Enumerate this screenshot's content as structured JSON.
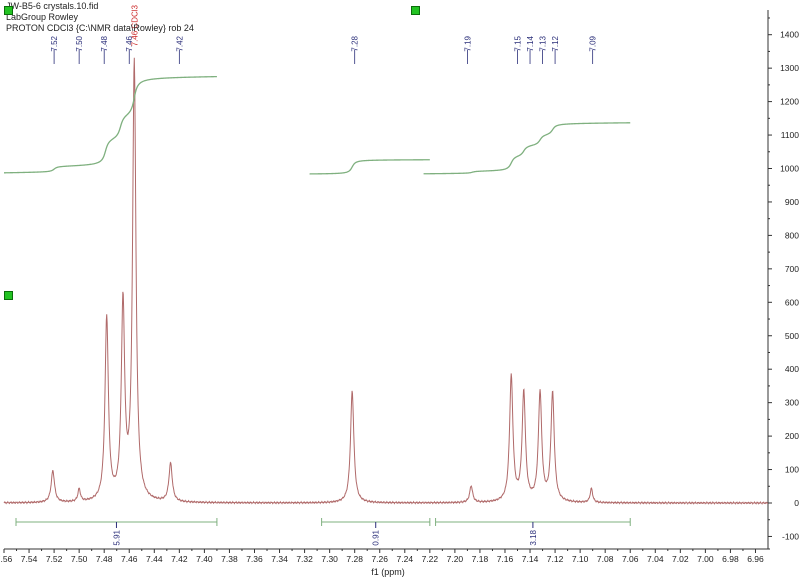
{
  "header": {
    "line1": "JW-B5-6 crystals.10.fid",
    "line2": "LabGroup Rowley",
    "line3": "PROTON CDCl3 {C:\\NMR data\\Rowley} rob 24"
  },
  "chart_data": {
    "type": "line",
    "title": "",
    "xlabel": "f1 (ppm)",
    "ylabel": "",
    "xlim": [
      7.56,
      6.95
    ],
    "ylim": [
      -130,
      1450
    ],
    "x_reversed": true,
    "x_ticks": [
      "7.56",
      "7.54",
      "7.52",
      "7.50",
      "7.48",
      "7.46",
      "7.44",
      "7.42",
      "7.40",
      "7.38",
      "7.36",
      "7.34",
      "7.32",
      "7.30",
      "7.28",
      "7.26",
      "7.24",
      "7.22",
      "7.20",
      "7.18",
      "7.16",
      "7.14",
      "7.12",
      "7.10",
      "7.08",
      "7.06",
      "7.04",
      "7.02",
      "7.00",
      "6.98",
      "6.96"
    ],
    "y_ticks": [
      "-100",
      "0",
      "100",
      "200",
      "300",
      "400",
      "500",
      "600",
      "700",
      "800",
      "900",
      "1000",
      "1100",
      "1200",
      "1300",
      "1400"
    ],
    "series": [
      {
        "color": "#b06a6a",
        "peaks": [
          {
            "x": 7.521,
            "y": 95,
            "w": 0.0016
          },
          {
            "x": 7.5,
            "y": 38,
            "w": 0.0012
          },
          {
            "x": 7.478,
            "y": 550,
            "w": 0.0016
          },
          {
            "x": 7.465,
            "y": 585,
            "w": 0.0016
          },
          {
            "x": 7.456,
            "y": 1310,
            "w": 0.0016
          },
          {
            "x": 7.427,
            "y": 115,
            "w": 0.0016
          },
          {
            "x": 7.282,
            "y": 335,
            "w": 0.0016
          },
          {
            "x": 7.187,
            "y": 50,
            "w": 0.0014
          },
          {
            "x": 7.155,
            "y": 375,
            "w": 0.0016
          },
          {
            "x": 7.145,
            "y": 325,
            "w": 0.0016
          },
          {
            "x": 7.132,
            "y": 325,
            "w": 0.0016
          },
          {
            "x": 7.122,
            "y": 325,
            "w": 0.0016
          },
          {
            "x": 7.091,
            "y": 42,
            "w": 0.0012
          }
        ]
      }
    ],
    "integral_color": "#7fb07f",
    "integrals": [
      {
        "from": 7.56,
        "to": 7.39,
        "label": "5.91",
        "steps": [
          [
            7.52,
            0.06
          ],
          [
            7.479,
            0.28
          ],
          [
            7.467,
            0.26
          ],
          [
            7.456,
            0.4
          ]
        ]
      },
      {
        "from": 7.316,
        "to": 7.22,
        "label": "0.91",
        "steps": [
          [
            7.282,
            1.0
          ]
        ]
      },
      {
        "from": 7.225,
        "to": 7.06,
        "label": "3.18",
        "steps": [
          [
            7.186,
            0.04
          ],
          [
            7.155,
            0.3
          ],
          [
            7.145,
            0.22
          ],
          [
            7.132,
            0.22
          ],
          [
            7.122,
            0.22
          ]
        ]
      }
    ],
    "peak_labels": [
      {
        "x": 7.52,
        "text": "7.52"
      },
      {
        "x": 7.5,
        "text": "7.50"
      },
      {
        "x": 7.48,
        "text": "7.48"
      },
      {
        "x": 7.46,
        "text": "7.46"
      },
      {
        "x": 7.42,
        "text": "7.42"
      },
      {
        "x": 7.28,
        "text": "7.28"
      },
      {
        "x": 7.19,
        "text": "7.19"
      },
      {
        "x": 7.15,
        "text": "7.15"
      },
      {
        "x": 7.14,
        "text": "7.14"
      },
      {
        "x": 7.13,
        "text": "7.13"
      },
      {
        "x": 7.12,
        "text": "7.12"
      },
      {
        "x": 7.09,
        "text": "7.09"
      }
    ],
    "solvent_label": {
      "x": 7.456,
      "text": "7.46 CDCl3"
    }
  },
  "colors": {
    "peak_label": "#2b2f7a",
    "solvent_label": "#cc2a2a",
    "axis": "#333333"
  }
}
